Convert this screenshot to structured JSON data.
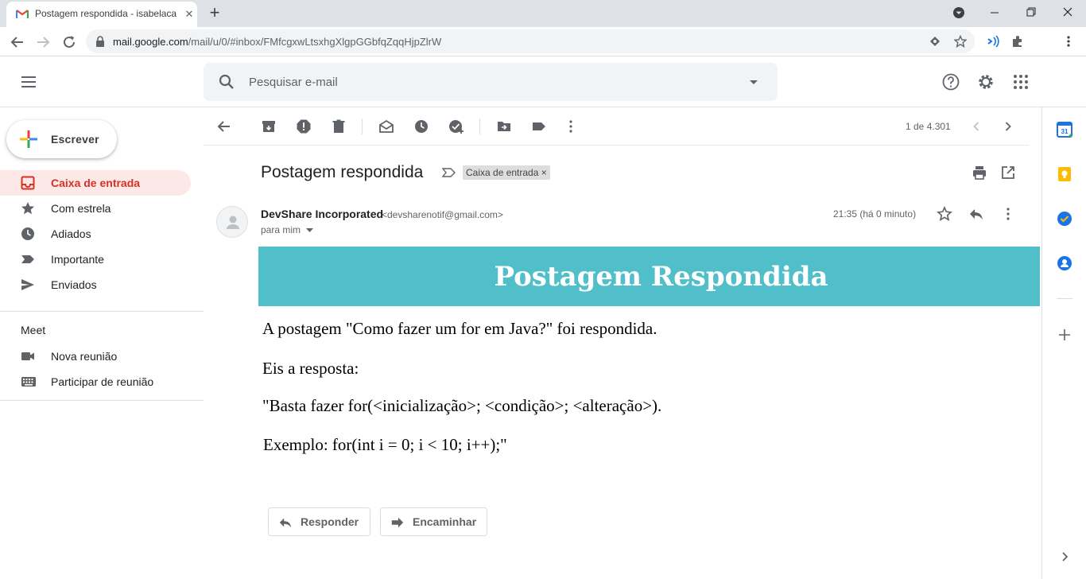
{
  "browser": {
    "tab_title": "Postagem respondida - isabelaca",
    "url_host": "mail.google.com",
    "url_path": "/mail/u/0/#inbox/FMfcgxwLtsxhgXlgpGGbfqZqqHjpZlrW"
  },
  "gmail": {
    "search_placeholder": "Pesquisar e-mail",
    "compose_label": "Escrever",
    "nav": [
      {
        "label": "Caixa de entrada",
        "icon": "inbox-icon"
      },
      {
        "label": "Com estrela",
        "icon": "star-icon"
      },
      {
        "label": "Adiados",
        "icon": "clock-icon"
      },
      {
        "label": "Importante",
        "icon": "important-icon"
      },
      {
        "label": "Enviados",
        "icon": "send-icon"
      }
    ],
    "meet": {
      "title": "Meet",
      "items": [
        {
          "label": "Nova reunião",
          "icon": "video-icon"
        },
        {
          "label": "Participar de reunião",
          "icon": "keyboard-icon"
        }
      ]
    },
    "pager": "1 de 4.301"
  },
  "message": {
    "subject": "Postagem respondida",
    "label": "Caixa de entrada",
    "label_close": "×",
    "sender_name": "DevShare Incorporated",
    "sender_email": "<devsharenotif@gmail.com>",
    "recipient": "para mim",
    "timestamp": "21:35 (há 0 minuto)",
    "banner_title": "Postagem Respondida",
    "body": [
      "A postagem \"Como fazer um for em Java?\" foi respondida.",
      "Eis a resposta:",
      "\"Basta fazer for(<inicialização>; <condição>; <alteração>).",
      "Exemplo: for(int i = 0; i < 10; i++);\""
    ],
    "reply_label": "Responder",
    "forward_label": "Encaminhar"
  },
  "colors": {
    "banner": "#50bfc9",
    "active_nav_bg": "#fce8e6",
    "active_nav_text": "#d93025"
  }
}
